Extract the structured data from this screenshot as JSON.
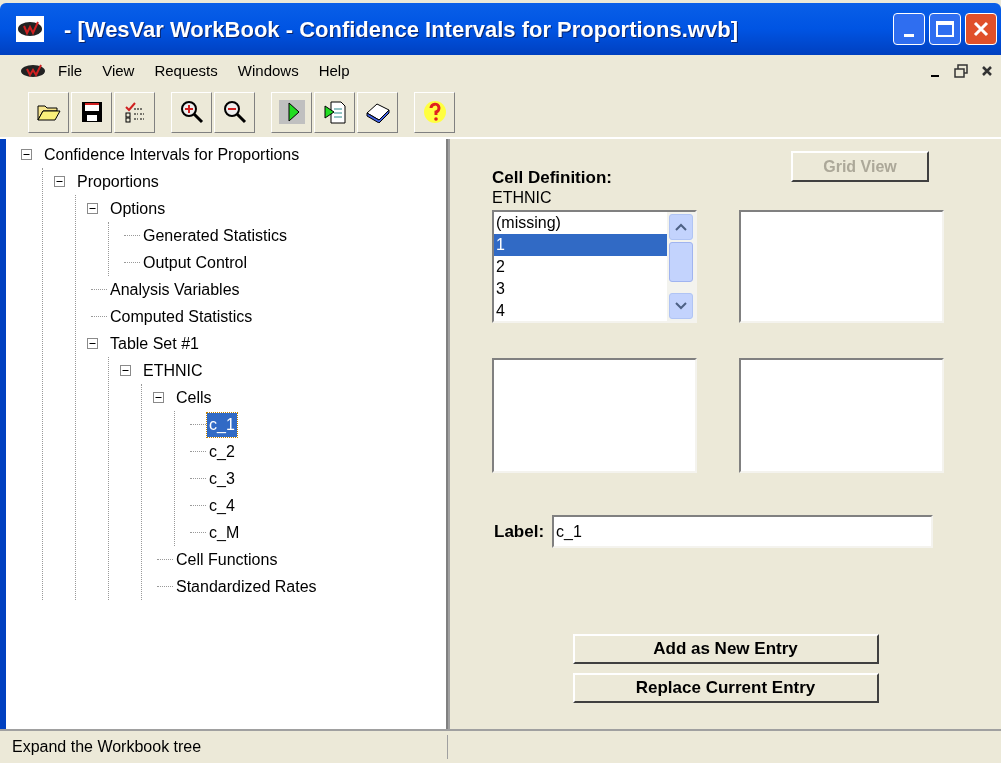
{
  "window": {
    "title": "- [WesVar WorkBook - Confidence Intervals for Proportions.wvb]"
  },
  "menu": [
    "File",
    "View",
    "Requests",
    "Windows",
    "Help"
  ],
  "tree": [
    {
      "label": "Confidence Intervals for Proportions",
      "expanded": true,
      "selected": false,
      "children": [
        {
          "label": "Proportions",
          "expanded": true,
          "selected": false,
          "children": [
            {
              "label": "Options",
              "expanded": true,
              "selected": false,
              "children": [
                {
                  "label": "Generated Statistics",
                  "selected": false
                },
                {
                  "label": "Output Control",
                  "selected": false
                }
              ]
            },
            {
              "label": "Analysis Variables",
              "selected": false
            },
            {
              "label": "Computed Statistics",
              "selected": false
            },
            {
              "label": "Table Set #1",
              "expanded": true,
              "selected": false,
              "children": [
                {
                  "label": "ETHNIC",
                  "expanded": true,
                  "selected": false,
                  "children": [
                    {
                      "label": "Cells",
                      "expanded": true,
                      "selected": false,
                      "children": [
                        {
                          "label": "c_1",
                          "selected": true
                        },
                        {
                          "label": "c_2",
                          "selected": false
                        },
                        {
                          "label": "c_3",
                          "selected": false
                        },
                        {
                          "label": "c_4",
                          "selected": false
                        },
                        {
                          "label": "c_M",
                          "selected": false
                        }
                      ]
                    },
                    {
                      "label": "Cell Functions",
                      "selected": false
                    },
                    {
                      "label": "Standardized Rates",
                      "selected": false
                    }
                  ]
                }
              ]
            }
          ]
        }
      ]
    }
  ],
  "grid_view_button": {
    "label": "Grid View",
    "disabled": true
  },
  "cell_definition": {
    "heading": "Cell Definition:",
    "variable": "ETHNIC",
    "values": [
      {
        "label": "(missing)",
        "selected": false
      },
      {
        "label": "1",
        "selected": true
      },
      {
        "label": "2",
        "selected": false
      },
      {
        "label": "3",
        "selected": false
      },
      {
        "label": "4",
        "selected": false
      }
    ]
  },
  "label_field": {
    "label": "Label:",
    "value": "c_1"
  },
  "buttons": [
    "Add as New Entry",
    "Replace Current Entry"
  ],
  "status_bar": "Expand the Workbook tree"
}
